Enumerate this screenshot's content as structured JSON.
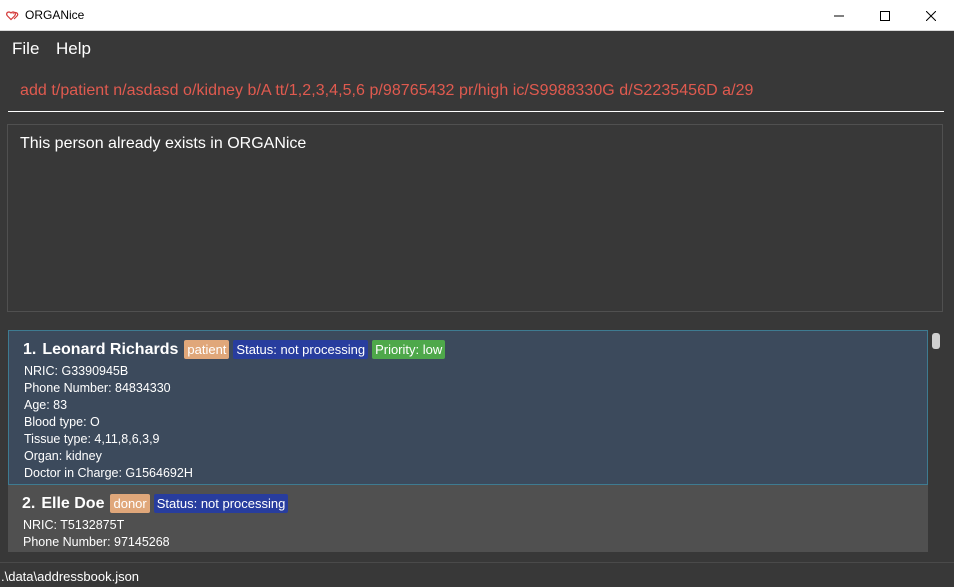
{
  "window": {
    "title": "ORGANice",
    "icon": "heart-icon",
    "controls": [
      "minimize-icon",
      "maximize-icon",
      "close-icon"
    ]
  },
  "menu": {
    "file": "File",
    "help": "Help"
  },
  "command": {
    "value": "add t/patient n/asdasd o/kidney b/A tt/1,2,3,4,5,6 p/98765432 pr/high ic/S9988330G d/S2235456D a/29"
  },
  "result": {
    "message": "This person already exists in ORGANice"
  },
  "persons": [
    {
      "index": "1.",
      "name": "Leonard Richards",
      "type": "patient",
      "status": "Status: not processing",
      "priority": "Priority: low",
      "lines": [
        "NRIC: G3390945B",
        "Phone Number: 84834330",
        "Age: 83",
        "Blood type: O",
        "Tissue type: 4,11,8,6,3,9",
        "Organ: kidney",
        "Doctor in Charge: G1564692H"
      ]
    },
    {
      "index": "2.",
      "name": "Elle Doe",
      "type": "donor",
      "status": "Status: not processing",
      "lines": [
        "NRIC: T5132875T",
        "Phone Number: 97145268"
      ]
    }
  ],
  "statusbar": {
    "path": ".\\data\\addressbook.json"
  },
  "colors": {
    "background": "#383838",
    "command_text": "#e05a4f",
    "selected_card": "#3c4a5c",
    "tag_type": "#e0a77a",
    "tag_status": "#283d9e",
    "tag_priority": "#4ea84a"
  }
}
